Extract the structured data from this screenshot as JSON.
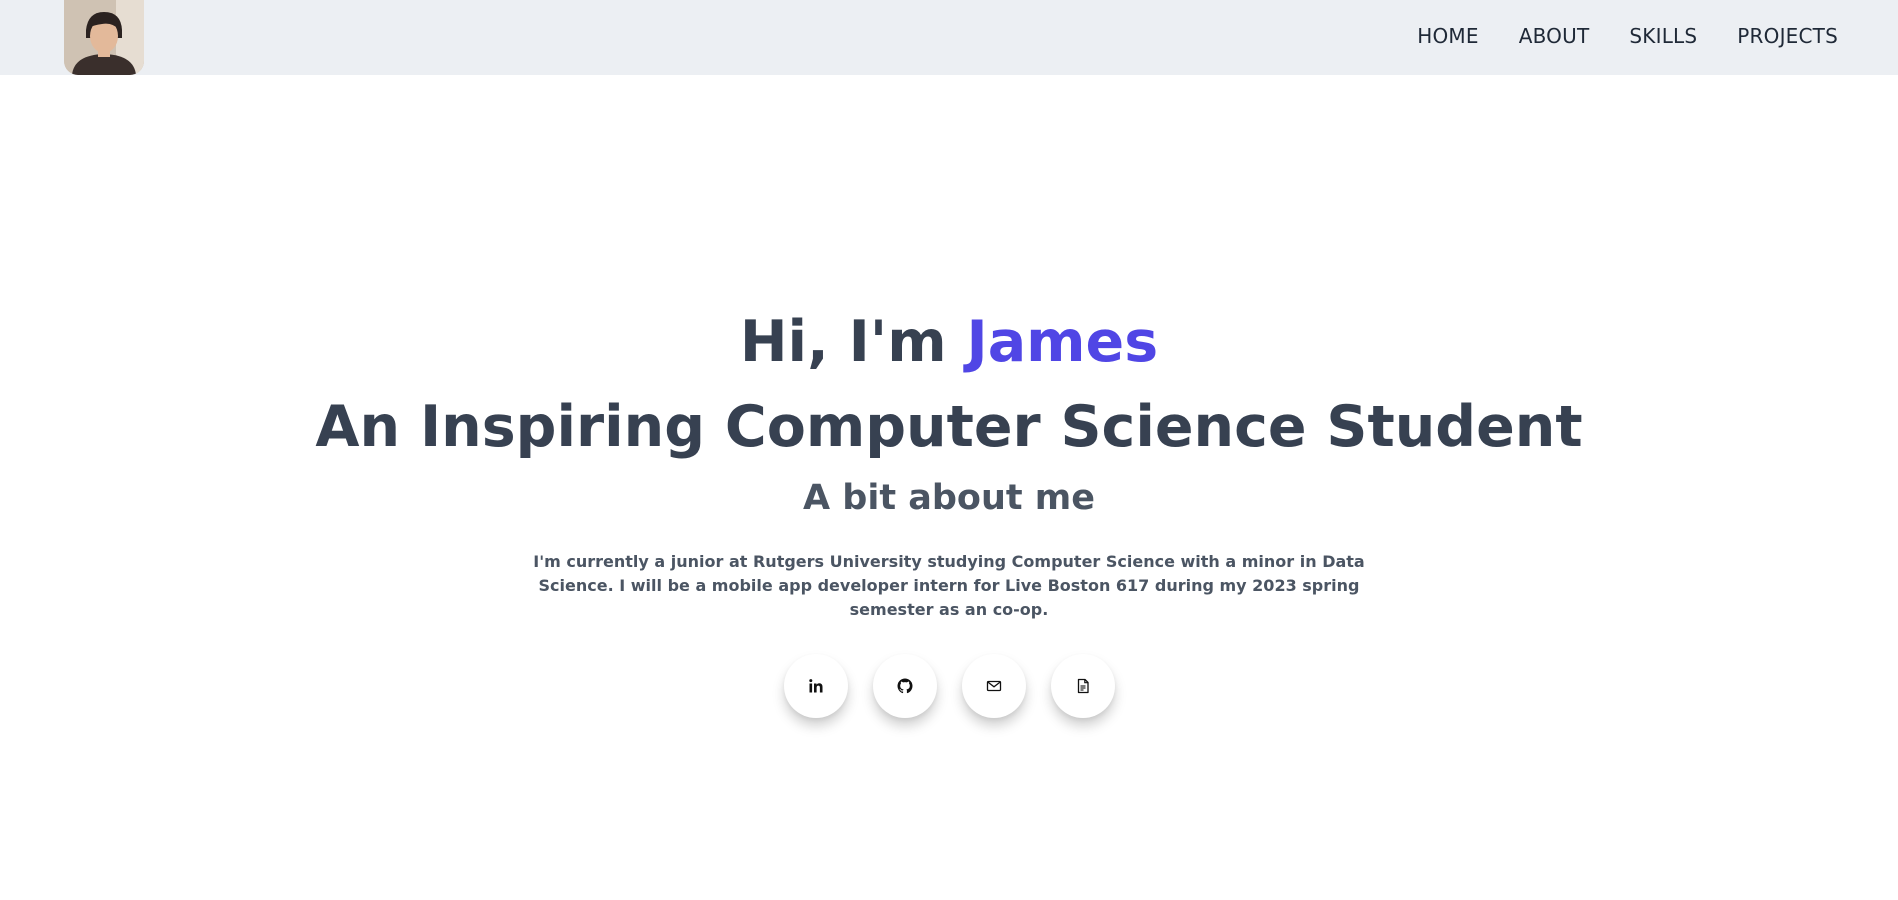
{
  "nav": {
    "avatar_icon": "profile-photo",
    "links": [
      "HOME",
      "ABOUT",
      "SKILLS",
      "PROJECTS"
    ]
  },
  "hero": {
    "greeting_prefix": "Hi, I'm ",
    "greeting_name": "James",
    "headline": "An Inspiring Computer Science Student",
    "subheading": "A bit about me",
    "bio": "I'm currently a junior at Rutgers University studying Computer Science with a minor in Data Science. I will be a mobile app developer intern for Live Boston 617 during my 2023 spring semester as an co-op."
  },
  "socials": [
    {
      "icon": "linkedin-icon"
    },
    {
      "icon": "github-icon"
    },
    {
      "icon": "mail-icon"
    },
    {
      "icon": "document-icon"
    }
  ],
  "colors": {
    "accent": "#5046e5",
    "text": "#374151",
    "navbar_bg": "#eceff3"
  }
}
